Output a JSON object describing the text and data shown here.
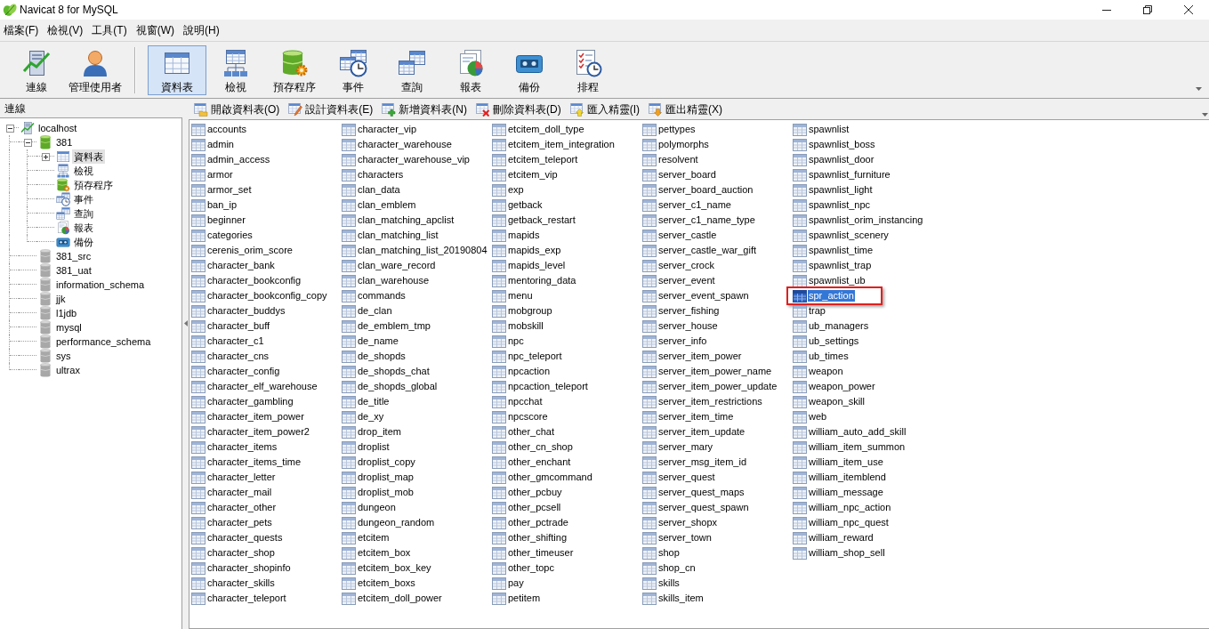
{
  "window": {
    "title": "Navicat 8 for MySQL"
  },
  "menu": [
    "檔案(F)",
    "檢視(V)",
    "工具(T)",
    "視窗(W)",
    "說明(H)"
  ],
  "toolbar": {
    "groups": [
      {
        "buttons": [
          {
            "label": "連線",
            "kind": "connection",
            "selected": false
          },
          {
            "label": "管理使用者",
            "kind": "user",
            "selected": false
          }
        ]
      },
      {
        "buttons": [
          {
            "label": "資料表",
            "kind": "tables",
            "selected": true
          },
          {
            "label": "檢視",
            "kind": "views",
            "selected": false
          },
          {
            "label": "預存程序",
            "kind": "procedures",
            "selected": false
          },
          {
            "label": "事件",
            "kind": "events",
            "selected": false
          },
          {
            "label": "查詢",
            "kind": "queries",
            "selected": false
          },
          {
            "label": "報表",
            "kind": "reports",
            "selected": false
          },
          {
            "label": "備份",
            "kind": "backups",
            "selected": false
          },
          {
            "label": "排程",
            "kind": "schedules",
            "selected": false
          }
        ]
      }
    ]
  },
  "sidebar": {
    "title": "連線",
    "tree": [
      {
        "label": "localhost",
        "kind": "connection",
        "expanded": true,
        "selected": false,
        "children": [
          {
            "label": "381",
            "kind": "database",
            "open": true,
            "expanded": true,
            "selected": false,
            "children": [
              {
                "label": "資料表",
                "kind": "tables",
                "expanded": false,
                "selected": true
              },
              {
                "label": "檢視",
                "kind": "views",
                "selected": false
              },
              {
                "label": "預存程序",
                "kind": "procedures",
                "selected": false
              },
              {
                "label": "事件",
                "kind": "events",
                "selected": false
              },
              {
                "label": "查詢",
                "kind": "queries",
                "selected": false
              },
              {
                "label": "報表",
                "kind": "reports",
                "selected": false
              },
              {
                "label": "備份",
                "kind": "backups",
                "selected": false
              }
            ]
          },
          {
            "label": "381_src",
            "kind": "database",
            "open": false,
            "selected": false
          },
          {
            "label": "381_uat",
            "kind": "database",
            "open": false,
            "selected": false
          },
          {
            "label": "information_schema",
            "kind": "database",
            "open": false,
            "selected": false
          },
          {
            "label": "jjk",
            "kind": "database",
            "open": false,
            "selected": false
          },
          {
            "label": "l1jdb",
            "kind": "database",
            "open": false,
            "selected": false
          },
          {
            "label": "mysql",
            "kind": "database",
            "open": false,
            "selected": false
          },
          {
            "label": "performance_schema",
            "kind": "database",
            "open": false,
            "selected": false
          },
          {
            "label": "sys",
            "kind": "database",
            "open": false,
            "selected": false
          },
          {
            "label": "ultrax",
            "kind": "database",
            "open": false,
            "selected": false
          }
        ]
      }
    ]
  },
  "object_toolbar": [
    {
      "label": "開啟資料表(O)",
      "kind": "open"
    },
    {
      "label": "設計資料表(E)",
      "kind": "design"
    },
    {
      "label": "新增資料表(N)",
      "kind": "new"
    },
    {
      "label": "刪除資料表(D)",
      "kind": "delete"
    },
    {
      "label": "匯入精靈(I)",
      "kind": "import"
    },
    {
      "label": "匯出精靈(X)",
      "kind": "export"
    }
  ],
  "tables": [
    {
      "name": "accounts",
      "selected": false,
      "outlined": false
    },
    {
      "name": "admin",
      "selected": false,
      "outlined": false
    },
    {
      "name": "admin_access",
      "selected": false,
      "outlined": false
    },
    {
      "name": "armor",
      "selected": false,
      "outlined": false
    },
    {
      "name": "armor_set",
      "selected": false,
      "outlined": false
    },
    {
      "name": "ban_ip",
      "selected": false,
      "outlined": false
    },
    {
      "name": "beginner",
      "selected": false,
      "outlined": false
    },
    {
      "name": "categories",
      "selected": false,
      "outlined": false
    },
    {
      "name": "cerenis_orim_score",
      "selected": false,
      "outlined": false
    },
    {
      "name": "character_bank",
      "selected": false,
      "outlined": false
    },
    {
      "name": "character_bookconfig",
      "selected": false,
      "outlined": false
    },
    {
      "name": "character_bookconfig_copy",
      "selected": false,
      "outlined": false
    },
    {
      "name": "character_buddys",
      "selected": false,
      "outlined": false
    },
    {
      "name": "character_buff",
      "selected": false,
      "outlined": false
    },
    {
      "name": "character_c1",
      "selected": false,
      "outlined": false
    },
    {
      "name": "character_cns",
      "selected": false,
      "outlined": false
    },
    {
      "name": "character_config",
      "selected": false,
      "outlined": false
    },
    {
      "name": "character_elf_warehouse",
      "selected": false,
      "outlined": false
    },
    {
      "name": "character_gambling",
      "selected": false,
      "outlined": false
    },
    {
      "name": "character_item_power",
      "selected": false,
      "outlined": false
    },
    {
      "name": "character_item_power2",
      "selected": false,
      "outlined": false
    },
    {
      "name": "character_items",
      "selected": false,
      "outlined": false
    },
    {
      "name": "character_items_time",
      "selected": false,
      "outlined": false
    },
    {
      "name": "character_letter",
      "selected": false,
      "outlined": false
    },
    {
      "name": "character_mail",
      "selected": false,
      "outlined": false
    },
    {
      "name": "character_other",
      "selected": false,
      "outlined": false
    },
    {
      "name": "character_pets",
      "selected": false,
      "outlined": false
    },
    {
      "name": "character_quests",
      "selected": false,
      "outlined": false
    },
    {
      "name": "character_shop",
      "selected": false,
      "outlined": false
    },
    {
      "name": "character_shopinfo",
      "selected": false,
      "outlined": false
    },
    {
      "name": "character_skills",
      "selected": false,
      "outlined": false
    },
    {
      "name": "character_teleport",
      "selected": false,
      "outlined": false
    },
    {
      "name": "character_vip",
      "selected": false,
      "outlined": false
    },
    {
      "name": "character_warehouse",
      "selected": false,
      "outlined": false
    },
    {
      "name": "character_warehouse_vip",
      "selected": false,
      "outlined": false
    },
    {
      "name": "characters",
      "selected": false,
      "outlined": false
    },
    {
      "name": "clan_data",
      "selected": false,
      "outlined": false
    },
    {
      "name": "clan_emblem",
      "selected": false,
      "outlined": false
    },
    {
      "name": "clan_matching_apclist",
      "selected": false,
      "outlined": false
    },
    {
      "name": "clan_matching_list",
      "selected": false,
      "outlined": false
    },
    {
      "name": "clan_matching_list_20190804",
      "selected": false,
      "outlined": false
    },
    {
      "name": "clan_ware_record",
      "selected": false,
      "outlined": false
    },
    {
      "name": "clan_warehouse",
      "selected": false,
      "outlined": false
    },
    {
      "name": "commands",
      "selected": false,
      "outlined": false
    },
    {
      "name": "de_clan",
      "selected": false,
      "outlined": false
    },
    {
      "name": "de_emblem_tmp",
      "selected": false,
      "outlined": false
    },
    {
      "name": "de_name",
      "selected": false,
      "outlined": false
    },
    {
      "name": "de_shopds",
      "selected": false,
      "outlined": false
    },
    {
      "name": "de_shopds_chat",
      "selected": false,
      "outlined": false
    },
    {
      "name": "de_shopds_global",
      "selected": false,
      "outlined": false
    },
    {
      "name": "de_title",
      "selected": false,
      "outlined": false
    },
    {
      "name": "de_xy",
      "selected": false,
      "outlined": false
    },
    {
      "name": "drop_item",
      "selected": false,
      "outlined": false
    },
    {
      "name": "droplist",
      "selected": false,
      "outlined": false
    },
    {
      "name": "droplist_copy",
      "selected": false,
      "outlined": false
    },
    {
      "name": "droplist_map",
      "selected": false,
      "outlined": false
    },
    {
      "name": "droplist_mob",
      "selected": false,
      "outlined": false
    },
    {
      "name": "dungeon",
      "selected": false,
      "outlined": false
    },
    {
      "name": "dungeon_random",
      "selected": false,
      "outlined": false
    },
    {
      "name": "etcitem",
      "selected": false,
      "outlined": false
    },
    {
      "name": "etcitem_box",
      "selected": false,
      "outlined": false
    },
    {
      "name": "etcitem_box_key",
      "selected": false,
      "outlined": false
    },
    {
      "name": "etcitem_boxs",
      "selected": false,
      "outlined": false
    },
    {
      "name": "etcitem_doll_power",
      "selected": false,
      "outlined": false
    },
    {
      "name": "etcitem_doll_type",
      "selected": false,
      "outlined": false
    },
    {
      "name": "etcitem_item_integration",
      "selected": false,
      "outlined": false
    },
    {
      "name": "etcitem_teleport",
      "selected": false,
      "outlined": false
    },
    {
      "name": "etcitem_vip",
      "selected": false,
      "outlined": false
    },
    {
      "name": "exp",
      "selected": false,
      "outlined": false
    },
    {
      "name": "getback",
      "selected": false,
      "outlined": false
    },
    {
      "name": "getback_restart",
      "selected": false,
      "outlined": false
    },
    {
      "name": "mapids",
      "selected": false,
      "outlined": false
    },
    {
      "name": "mapids_exp",
      "selected": false,
      "outlined": false
    },
    {
      "name": "mapids_level",
      "selected": false,
      "outlined": false
    },
    {
      "name": "mentoring_data",
      "selected": false,
      "outlined": false
    },
    {
      "name": "menu",
      "selected": false,
      "outlined": false
    },
    {
      "name": "mobgroup",
      "selected": false,
      "outlined": false
    },
    {
      "name": "mobskill",
      "selected": false,
      "outlined": false
    },
    {
      "name": "npc",
      "selected": false,
      "outlined": false
    },
    {
      "name": "npc_teleport",
      "selected": false,
      "outlined": false
    },
    {
      "name": "npcaction",
      "selected": false,
      "outlined": false
    },
    {
      "name": "npcaction_teleport",
      "selected": false,
      "outlined": false
    },
    {
      "name": "npcchat",
      "selected": false,
      "outlined": false
    },
    {
      "name": "npcscore",
      "selected": false,
      "outlined": false
    },
    {
      "name": "other_chat",
      "selected": false,
      "outlined": false
    },
    {
      "name": "other_cn_shop",
      "selected": false,
      "outlined": false
    },
    {
      "name": "other_enchant",
      "selected": false,
      "outlined": false
    },
    {
      "name": "other_gmcommand",
      "selected": false,
      "outlined": false
    },
    {
      "name": "other_pcbuy",
      "selected": false,
      "outlined": false
    },
    {
      "name": "other_pcsell",
      "selected": false,
      "outlined": false
    },
    {
      "name": "other_pctrade",
      "selected": false,
      "outlined": false
    },
    {
      "name": "other_shifting",
      "selected": false,
      "outlined": false
    },
    {
      "name": "other_timeuser",
      "selected": false,
      "outlined": false
    },
    {
      "name": "other_topc",
      "selected": false,
      "outlined": false
    },
    {
      "name": "pay",
      "selected": false,
      "outlined": false
    },
    {
      "name": "petitem",
      "selected": false,
      "outlined": false
    },
    {
      "name": "pettypes",
      "selected": false,
      "outlined": false
    },
    {
      "name": "polymorphs",
      "selected": false,
      "outlined": false
    },
    {
      "name": "resolvent",
      "selected": false,
      "outlined": false
    },
    {
      "name": "server_board",
      "selected": false,
      "outlined": false
    },
    {
      "name": "server_board_auction",
      "selected": false,
      "outlined": false
    },
    {
      "name": "server_c1_name",
      "selected": false,
      "outlined": false
    },
    {
      "name": "server_c1_name_type",
      "selected": false,
      "outlined": false
    },
    {
      "name": "server_castle",
      "selected": false,
      "outlined": false
    },
    {
      "name": "server_castle_war_gift",
      "selected": false,
      "outlined": false
    },
    {
      "name": "server_crock",
      "selected": false,
      "outlined": false
    },
    {
      "name": "server_event",
      "selected": false,
      "outlined": false
    },
    {
      "name": "server_event_spawn",
      "selected": false,
      "outlined": false
    },
    {
      "name": "server_fishing",
      "selected": false,
      "outlined": false
    },
    {
      "name": "server_house",
      "selected": false,
      "outlined": false
    },
    {
      "name": "server_info",
      "selected": false,
      "outlined": false
    },
    {
      "name": "server_item_power",
      "selected": false,
      "outlined": false
    },
    {
      "name": "server_item_power_name",
      "selected": false,
      "outlined": false
    },
    {
      "name": "server_item_power_update",
      "selected": false,
      "outlined": false
    },
    {
      "name": "server_item_restrictions",
      "selected": false,
      "outlined": false
    },
    {
      "name": "server_item_time",
      "selected": false,
      "outlined": false
    },
    {
      "name": "server_item_update",
      "selected": false,
      "outlined": false
    },
    {
      "name": "server_mary",
      "selected": false,
      "outlined": false
    },
    {
      "name": "server_msg_item_id",
      "selected": false,
      "outlined": false
    },
    {
      "name": "server_quest",
      "selected": false,
      "outlined": false
    },
    {
      "name": "server_quest_maps",
      "selected": false,
      "outlined": false
    },
    {
      "name": "server_quest_spawn",
      "selected": false,
      "outlined": false
    },
    {
      "name": "server_shopx",
      "selected": false,
      "outlined": false
    },
    {
      "name": "server_town",
      "selected": false,
      "outlined": false
    },
    {
      "name": "shop",
      "selected": false,
      "outlined": false
    },
    {
      "name": "shop_cn",
      "selected": false,
      "outlined": false
    },
    {
      "name": "skills",
      "selected": false,
      "outlined": false
    },
    {
      "name": "skills_item",
      "selected": false,
      "outlined": false
    },
    {
      "name": "spawnlist",
      "selected": false,
      "outlined": false
    },
    {
      "name": "spawnlist_boss",
      "selected": false,
      "outlined": false
    },
    {
      "name": "spawnlist_door",
      "selected": false,
      "outlined": false
    },
    {
      "name": "spawnlist_furniture",
      "selected": false,
      "outlined": false
    },
    {
      "name": "spawnlist_light",
      "selected": false,
      "outlined": false
    },
    {
      "name": "spawnlist_npc",
      "selected": false,
      "outlined": false
    },
    {
      "name": "spawnlist_orim_instancing",
      "selected": false,
      "outlined": false
    },
    {
      "name": "spawnlist_scenery",
      "selected": false,
      "outlined": false
    },
    {
      "name": "spawnlist_time",
      "selected": false,
      "outlined": false
    },
    {
      "name": "spawnlist_trap",
      "selected": false,
      "outlined": false
    },
    {
      "name": "spawnlist_ub",
      "selected": false,
      "outlined": false
    },
    {
      "name": "spr_action",
      "selected": true,
      "outlined": true
    },
    {
      "name": "trap",
      "selected": false,
      "outlined": false
    },
    {
      "name": "ub_managers",
      "selected": false,
      "outlined": false
    },
    {
      "name": "ub_settings",
      "selected": false,
      "outlined": false
    },
    {
      "name": "ub_times",
      "selected": false,
      "outlined": false
    },
    {
      "name": "weapon",
      "selected": false,
      "outlined": false
    },
    {
      "name": "weapon_power",
      "selected": false,
      "outlined": false
    },
    {
      "name": "weapon_skill",
      "selected": false,
      "outlined": false
    },
    {
      "name": "web",
      "selected": false,
      "outlined": false
    },
    {
      "name": "william_auto_add_skill",
      "selected": false,
      "outlined": false
    },
    {
      "name": "william_item_summon",
      "selected": false,
      "outlined": false
    },
    {
      "name": "william_item_use",
      "selected": false,
      "outlined": false
    },
    {
      "name": "william_itemblend",
      "selected": false,
      "outlined": false
    },
    {
      "name": "william_message",
      "selected": false,
      "outlined": false
    },
    {
      "name": "william_npc_action",
      "selected": false,
      "outlined": false
    },
    {
      "name": "william_npc_quest",
      "selected": false,
      "outlined": false
    },
    {
      "name": "william_reward",
      "selected": false,
      "outlined": false
    },
    {
      "name": "william_shop_sell",
      "selected": false,
      "outlined": false
    }
  ]
}
